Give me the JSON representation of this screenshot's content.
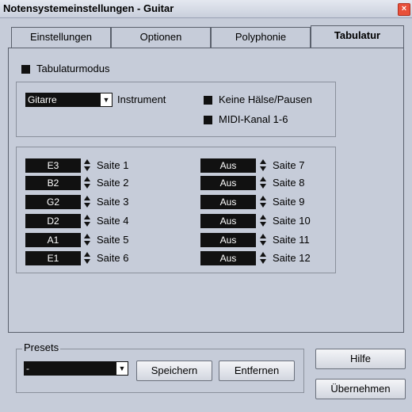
{
  "window": {
    "title": "Notensystemeinstellungen - Guitar",
    "close_glyph": "×"
  },
  "tabs": [
    {
      "label": "Einstellungen"
    },
    {
      "label": "Optionen"
    },
    {
      "label": "Polyphonie"
    },
    {
      "label": "Tabulatur",
      "active": true
    }
  ],
  "tabulatur": {
    "mode_label": "Tabulaturmodus",
    "instrument_value": "Gitarre",
    "instrument_label": "Instrument",
    "no_stems_label": "Keine Hälse/Pausen",
    "midi_channel_label": "MIDI-Kanal 1-6"
  },
  "strings_left": [
    {
      "value": "E3",
      "label": "Saite 1"
    },
    {
      "value": "B2",
      "label": "Saite 2"
    },
    {
      "value": "G2",
      "label": "Saite 3"
    },
    {
      "value": "D2",
      "label": "Saite 4"
    },
    {
      "value": "A1",
      "label": "Saite 5"
    },
    {
      "value": "E1",
      "label": "Saite 6"
    }
  ],
  "strings_right": [
    {
      "value": "Aus",
      "label": "Saite 7"
    },
    {
      "value": "Aus",
      "label": "Saite 8"
    },
    {
      "value": "Aus",
      "label": "Saite 9"
    },
    {
      "value": "Aus",
      "label": "Saite 10"
    },
    {
      "value": "Aus",
      "label": "Saite 11"
    },
    {
      "value": "Aus",
      "label": "Saite 12"
    }
  ],
  "presets": {
    "legend": "Presets",
    "value": "-",
    "save_label": "Speichern",
    "remove_label": "Entfernen"
  },
  "buttons": {
    "help_label": "Hilfe",
    "apply_label": "Übernehmen"
  }
}
